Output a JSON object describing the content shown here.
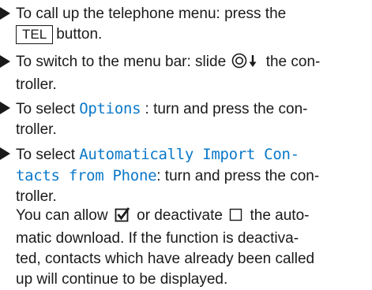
{
  "steps": [
    {
      "line1": "To call up the telephone menu: press the",
      "key": "TEL",
      "line2_after": "button."
    },
    {
      "pre": "To switch to the menu bar: slide",
      "post": "the con-",
      "line2": "troller."
    },
    {
      "pre": "To select",
      "mono": "Options",
      "post": ": turn and press the con-",
      "line2": "troller."
    },
    {
      "pre": "To select",
      "mono1": "Automatically Import Con-",
      "mono2": "tacts from Phone",
      "post2": ": turn and press the con-",
      "line3": "troller."
    }
  ],
  "note": {
    "pre": "You can allow",
    "mid": "or deactivate",
    "post": "the auto-",
    "line2": "matic download. If the function is deactiva-",
    "line3": "ted, contacts which have already been called",
    "line4": "up will continue to be displayed."
  },
  "icons": {
    "bullet": "right-triangle-bullet-icon",
    "controller": "controller-slide-down-icon",
    "checked": "checkbox-checked-icon",
    "unchecked": "checkbox-unchecked-icon"
  }
}
